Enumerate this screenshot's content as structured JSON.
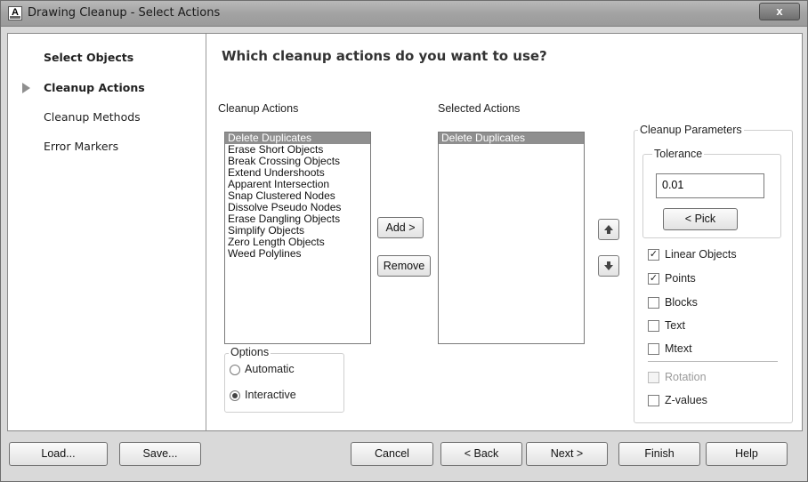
{
  "window": {
    "title": "Drawing Cleanup - Select Actions",
    "app_icon": "A",
    "close_label": "x"
  },
  "sidebar": {
    "items": [
      {
        "label": "Select Objects",
        "bold": true
      },
      {
        "label": "Cleanup Actions",
        "bold": true,
        "current": true
      },
      {
        "label": "Cleanup Methods",
        "bold": false
      },
      {
        "label": "Error Markers",
        "bold": false
      }
    ]
  },
  "main": {
    "heading": "Which cleanup actions do you want to use?",
    "cleanup_actions_label": "Cleanup Actions",
    "cleanup_actions": [
      "Delete Duplicates",
      "Erase Short Objects",
      "Break Crossing Objects",
      "Extend Undershoots",
      "Apparent Intersection",
      "Snap Clustered Nodes",
      "Dissolve Pseudo Nodes",
      "Erase Dangling Objects",
      "Simplify Objects",
      "Zero Length Objects",
      "Weed Polylines"
    ],
    "selected_actions_label": "Selected Actions",
    "selected_actions": [
      "Delete Duplicates"
    ],
    "add_label": "Add >",
    "remove_label": "Remove",
    "options": {
      "label": "Options",
      "automatic": "Automatic",
      "interactive": "Interactive",
      "selected": "interactive"
    }
  },
  "parameters": {
    "label": "Cleanup Parameters",
    "tolerance_label": "Tolerance",
    "tolerance_value": "0.01",
    "pick_label": "< Pick",
    "checkboxes": [
      {
        "label": "Linear Objects",
        "checked": true,
        "enabled": true
      },
      {
        "label": "Points",
        "checked": true,
        "enabled": true
      },
      {
        "label": "Blocks",
        "checked": false,
        "enabled": true
      },
      {
        "label": "Text",
        "checked": false,
        "enabled": true
      },
      {
        "label": "Mtext",
        "checked": false,
        "enabled": true
      },
      {
        "label": "Rotation",
        "checked": false,
        "enabled": false
      },
      {
        "label": "Z-values",
        "checked": false,
        "enabled": true
      }
    ]
  },
  "footer": {
    "load": "Load...",
    "save": "Save...",
    "cancel": "Cancel",
    "back": "< Back",
    "next": "Next >",
    "finish": "Finish",
    "help": "Help"
  },
  "icons": {
    "move_up": "arrow-up-icon",
    "move_down": "arrow-down-icon",
    "current_step": "current-step-arrow-icon"
  }
}
